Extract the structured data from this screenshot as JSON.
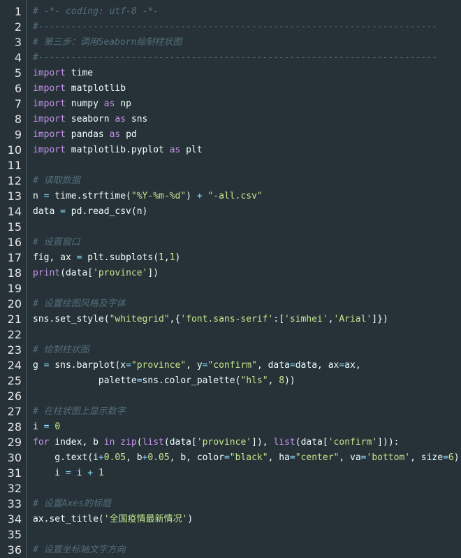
{
  "editor": {
    "language": "python",
    "line_numbers": [
      "1",
      "2",
      "3",
      "4",
      "5",
      "6",
      "7",
      "8",
      "9",
      "10",
      "11",
      "12",
      "13",
      "14",
      "15",
      "16",
      "17",
      "18",
      "19",
      "20",
      "21",
      "22",
      "23",
      "24",
      "25",
      "26",
      "27",
      "28",
      "29",
      "30",
      "31",
      "32",
      "33",
      "34",
      "35",
      "36"
    ],
    "lines": [
      [
        {
          "t": "cmt",
          "v": "# -*- coding: utf-8 -*-"
        }
      ],
      [
        {
          "t": "cmt",
          "v": "#-------------------------------------------------------------------------"
        }
      ],
      [
        {
          "t": "cmt",
          "v": "# 第三步：调用Seaborn绘制柱状图"
        }
      ],
      [
        {
          "t": "cmt",
          "v": "#-------------------------------------------------------------------------"
        }
      ],
      [
        {
          "t": "kw",
          "v": "import"
        },
        {
          "t": "id",
          "v": " time"
        }
      ],
      [
        {
          "t": "kw",
          "v": "import"
        },
        {
          "t": "id",
          "v": " matplotlib"
        }
      ],
      [
        {
          "t": "kw",
          "v": "import"
        },
        {
          "t": "id",
          "v": " numpy "
        },
        {
          "t": "kw",
          "v": "as"
        },
        {
          "t": "id",
          "v": " np"
        }
      ],
      [
        {
          "t": "kw",
          "v": "import"
        },
        {
          "t": "id",
          "v": " seaborn "
        },
        {
          "t": "kw",
          "v": "as"
        },
        {
          "t": "id",
          "v": " sns"
        }
      ],
      [
        {
          "t": "kw",
          "v": "import"
        },
        {
          "t": "id",
          "v": " pandas "
        },
        {
          "t": "kw",
          "v": "as"
        },
        {
          "t": "id",
          "v": " pd"
        }
      ],
      [
        {
          "t": "kw",
          "v": "import"
        },
        {
          "t": "id",
          "v": " matplotlib.pyplot "
        },
        {
          "t": "kw",
          "v": "as"
        },
        {
          "t": "id",
          "v": " plt"
        }
      ],
      [],
      [
        {
          "t": "cmt",
          "v": "# 读取数据"
        }
      ],
      [
        {
          "t": "id",
          "v": "n "
        },
        {
          "t": "op",
          "v": "="
        },
        {
          "t": "id",
          "v": " time.strftime("
        },
        {
          "t": "str",
          "v": "\"%Y-%m-%d\""
        },
        {
          "t": "id",
          "v": ") "
        },
        {
          "t": "op",
          "v": "+"
        },
        {
          "t": "id",
          "v": " "
        },
        {
          "t": "str",
          "v": "\"-all.csv\""
        }
      ],
      [
        {
          "t": "id",
          "v": "data "
        },
        {
          "t": "op",
          "v": "="
        },
        {
          "t": "id",
          "v": " pd.read_csv(n)"
        }
      ],
      [],
      [
        {
          "t": "cmt",
          "v": "# 设置窗口"
        }
      ],
      [
        {
          "t": "id",
          "v": "fig, ax "
        },
        {
          "t": "op",
          "v": "="
        },
        {
          "t": "id",
          "v": " plt.subplots("
        },
        {
          "t": "num",
          "v": "1"
        },
        {
          "t": "id",
          "v": ","
        },
        {
          "t": "num",
          "v": "1"
        },
        {
          "t": "id",
          "v": ")"
        }
      ],
      [
        {
          "t": "kw",
          "v": "print"
        },
        {
          "t": "id",
          "v": "(data["
        },
        {
          "t": "str",
          "v": "'province'"
        },
        {
          "t": "id",
          "v": "])"
        }
      ],
      [],
      [
        {
          "t": "cmt",
          "v": "# 设置绘图风格及字体"
        }
      ],
      [
        {
          "t": "id",
          "v": "sns.set_style("
        },
        {
          "t": "str",
          "v": "\"whitegrid\""
        },
        {
          "t": "id",
          "v": ",{"
        },
        {
          "t": "str",
          "v": "'font.sans-serif'"
        },
        {
          "t": "id",
          "v": ":["
        },
        {
          "t": "str",
          "v": "'simhei'"
        },
        {
          "t": "id",
          "v": ","
        },
        {
          "t": "str",
          "v": "'Arial'"
        },
        {
          "t": "id",
          "v": "]})"
        }
      ],
      [],
      [
        {
          "t": "cmt",
          "v": "# 绘制柱状图"
        }
      ],
      [
        {
          "t": "id",
          "v": "g "
        },
        {
          "t": "op",
          "v": "="
        },
        {
          "t": "id",
          "v": " sns.barplot(x"
        },
        {
          "t": "op",
          "v": "="
        },
        {
          "t": "str",
          "v": "\"province\""
        },
        {
          "t": "id",
          "v": ", y"
        },
        {
          "t": "op",
          "v": "="
        },
        {
          "t": "str",
          "v": "\"confirm\""
        },
        {
          "t": "id",
          "v": ", data"
        },
        {
          "t": "op",
          "v": "="
        },
        {
          "t": "id",
          "v": "data, ax"
        },
        {
          "t": "op",
          "v": "="
        },
        {
          "t": "id",
          "v": "ax,"
        }
      ],
      [
        {
          "t": "id",
          "v": "            palette"
        },
        {
          "t": "op",
          "v": "="
        },
        {
          "t": "id",
          "v": "sns.color_palette("
        },
        {
          "t": "str",
          "v": "\"hls\""
        },
        {
          "t": "id",
          "v": ", "
        },
        {
          "t": "num",
          "v": "8"
        },
        {
          "t": "id",
          "v": "))"
        }
      ],
      [],
      [
        {
          "t": "cmt",
          "v": "# 在柱状图上显示数字"
        }
      ],
      [
        {
          "t": "id",
          "v": "i "
        },
        {
          "t": "op",
          "v": "="
        },
        {
          "t": "id",
          "v": " "
        },
        {
          "t": "num",
          "v": "0"
        }
      ],
      [
        {
          "t": "kw",
          "v": "for"
        },
        {
          "t": "id",
          "v": " index, b "
        },
        {
          "t": "kw",
          "v": "in"
        },
        {
          "t": "id",
          "v": " "
        },
        {
          "t": "kw",
          "v": "zip"
        },
        {
          "t": "id",
          "v": "("
        },
        {
          "t": "kw",
          "v": "list"
        },
        {
          "t": "id",
          "v": "(data["
        },
        {
          "t": "str",
          "v": "'province'"
        },
        {
          "t": "id",
          "v": "]), "
        },
        {
          "t": "kw",
          "v": "list"
        },
        {
          "t": "id",
          "v": "(data["
        },
        {
          "t": "str",
          "v": "'confirm'"
        },
        {
          "t": "id",
          "v": "])):"
        }
      ],
      [
        {
          "t": "id",
          "v": "    g.text(i"
        },
        {
          "t": "op",
          "v": "+"
        },
        {
          "t": "num",
          "v": "0.05"
        },
        {
          "t": "id",
          "v": ", b"
        },
        {
          "t": "op",
          "v": "+"
        },
        {
          "t": "num",
          "v": "0.05"
        },
        {
          "t": "id",
          "v": ", b, color"
        },
        {
          "t": "op",
          "v": "="
        },
        {
          "t": "str",
          "v": "\"black\""
        },
        {
          "t": "id",
          "v": ", ha"
        },
        {
          "t": "op",
          "v": "="
        },
        {
          "t": "str",
          "v": "\"center\""
        },
        {
          "t": "id",
          "v": ", va"
        },
        {
          "t": "op",
          "v": "="
        },
        {
          "t": "str",
          "v": "'bottom'"
        },
        {
          "t": "id",
          "v": ", size"
        },
        {
          "t": "op",
          "v": "="
        },
        {
          "t": "num",
          "v": "6"
        },
        {
          "t": "id",
          "v": ")"
        }
      ],
      [
        {
          "t": "id",
          "v": "    i "
        },
        {
          "t": "op",
          "v": "="
        },
        {
          "t": "id",
          "v": " i "
        },
        {
          "t": "op",
          "v": "+"
        },
        {
          "t": "id",
          "v": " "
        },
        {
          "t": "num",
          "v": "1"
        }
      ],
      [],
      [
        {
          "t": "cmt",
          "v": "# 设置Axes的标题"
        }
      ],
      [
        {
          "t": "id",
          "v": "ax.set_title("
        },
        {
          "t": "str",
          "v": "'全国疫情最新情况'"
        },
        {
          "t": "id",
          "v": ")"
        }
      ],
      [],
      [
        {
          "t": "cmt",
          "v": "# 设置坐标轴文字方向"
        }
      ]
    ],
    "colors": {
      "background": "#263238",
      "keyword": "#c792ea",
      "string": "#c3e88d",
      "operator": "#89ddff",
      "comment": "#546e7a",
      "text": "#eeffff",
      "line_number": "#e6e6e6"
    }
  }
}
